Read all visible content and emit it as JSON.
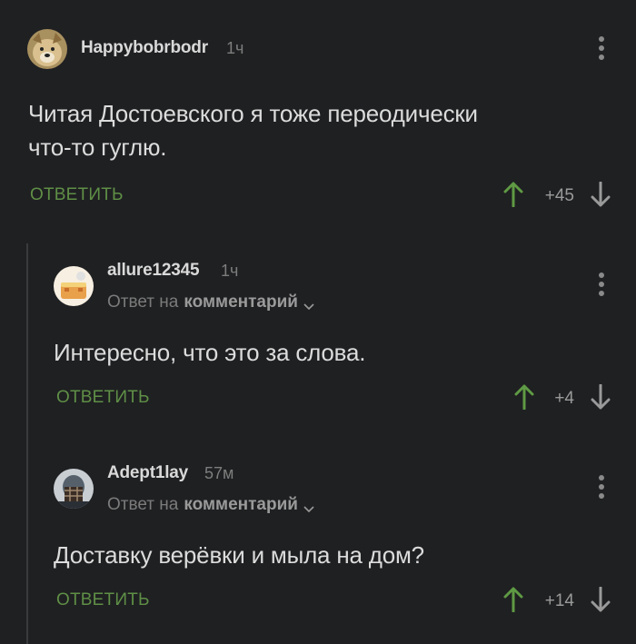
{
  "comments": [
    {
      "username": "Happybobrbodr",
      "time": "1ч",
      "text_line1": "Читая Достоевского я тоже переодически",
      "text_line2": "что-то гуглю.",
      "reply_label": "ОТВЕТИТЬ",
      "rating": "+45",
      "avatar_icon": "dog-avatar-icon"
    },
    {
      "username": "allure12345",
      "time": "1ч",
      "reply_prefix": "Ответ на",
      "reply_target": "комментарий",
      "text_line1": "Интересно, что это за слова.",
      "reply_label": "ОТВЕТИТЬ",
      "rating": "+4",
      "avatar_icon": "cake-avatar-icon"
    },
    {
      "username": "Adept1lay",
      "time": "57м",
      "reply_prefix": "Ответ на",
      "reply_target": "комментарий",
      "text_line1": "Доставку верёвки и мыла на дом?",
      "reply_label": "ОТВЕТИТЬ",
      "rating": "+14",
      "avatar_icon": "person-avatar-icon"
    }
  ],
  "colors": {
    "background": "#1f2022",
    "reply_green": "#5f8f46",
    "up_arrow_green": "#5f9a44",
    "thread_line": "#3a3b3d"
  }
}
